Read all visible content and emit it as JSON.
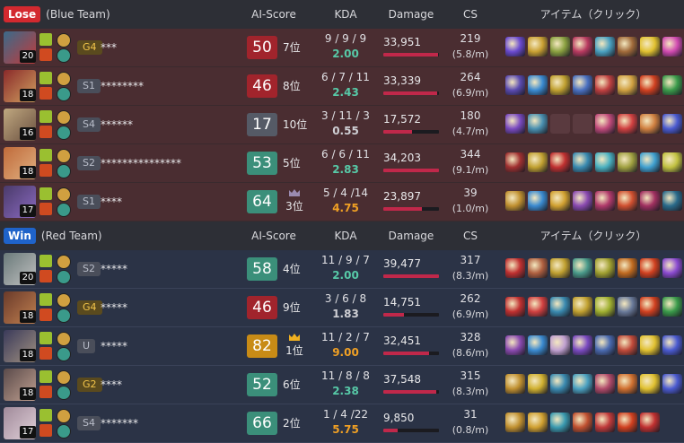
{
  "colors": {
    "score_red": "#a1242c",
    "score_green": "#3b8f7a",
    "score_gray": "#555a66",
    "score_gold": "#c88b16",
    "kda_green": "#57c9a7",
    "kda_gray": "#cfcfd4",
    "kda_orange": "#f0a024"
  },
  "headers": {
    "ai_score": "AI-Score",
    "kda": "KDA",
    "damage": "Damage",
    "cs": "CS",
    "items": "アイテム（クリック）"
  },
  "teams": [
    {
      "result": "Lose",
      "name": "(Blue Team)",
      "type": "lose",
      "players": [
        {
          "level": "20",
          "tier": "G4",
          "tier_type": "gold",
          "name": "***",
          "score": "50",
          "score_color": "score_red",
          "rank": "7位",
          "crown": false,
          "kda": "9 / 9 / 9",
          "kda_ratio": "2.00",
          "ratio_color": "kda_green",
          "damage": "33,951",
          "damage_frac": 0.99,
          "cs": "219",
          "cs_min": "(5.8/m)",
          "champ_colors": [
            "#3a6a8a",
            "#c23a3a"
          ],
          "items": [
            "#6a4ad0",
            "#c9a032",
            "#8aa040",
            "#b83a60",
            "#4aa0c0",
            "#a06a3a",
            "#e0c030",
            "#d04ab0"
          ]
        },
        {
          "level": "18",
          "tier": "S1",
          "tier_type": "gray",
          "name": "********",
          "score": "46",
          "score_color": "score_red",
          "rank": "8位",
          "crown": false,
          "kda": "6 / 7 / 11",
          "kda_ratio": "2.43",
          "ratio_color": "kda_green",
          "damage": "33,339",
          "damage_frac": 0.97,
          "cs": "264",
          "cs_min": "(6.9/m)",
          "champ_colors": [
            "#8a2a2a",
            "#d0a060"
          ],
          "items": [
            "#5a4ab0",
            "#3a8ad0",
            "#c0a030",
            "#4a70c0",
            "#c04040",
            "#d0a040",
            "#d04020",
            "#3a9a4a"
          ]
        },
        {
          "level": "16",
          "tier": "S4",
          "tier_type": "gray",
          "name": "******",
          "score": "17",
          "score_color": "score_gray",
          "rank": "10位",
          "crown": false,
          "kda": "3 / 11 / 3",
          "kda_ratio": "0.55",
          "ratio_color": "kda_gray",
          "damage": "17,572",
          "damage_frac": 0.51,
          "cs": "180",
          "cs_min": "(4.7/m)",
          "champ_colors": [
            "#c0a880",
            "#6a5040"
          ],
          "items": [
            "#7a4ac0",
            "#4a90b0",
            "",
            "",
            "#c04a7a",
            "#d04040",
            "#d08040",
            "#4a5ad0"
          ]
        },
        {
          "level": "18",
          "tier": "S2",
          "tier_type": "gray",
          "name": "***************",
          "score": "53",
          "score_color": "score_green",
          "rank": "5位",
          "crown": false,
          "kda": "6 / 6 / 11",
          "kda_ratio": "2.83",
          "ratio_color": "kda_green",
          "damage": "34,203",
          "damage_frac": 1.0,
          "cs": "344",
          "cs_min": "(9.1/m)",
          "champ_colors": [
            "#c06a3a",
            "#e0b080"
          ],
          "items": [
            "#a03030",
            "#c0a030",
            "#c03030",
            "#3a8ab0",
            "#4ab0c0",
            "#a0a040",
            "#40a0d0",
            "#c0c040"
          ]
        },
        {
          "level": "17",
          "tier": "S1",
          "tier_type": "gray",
          "name": "****",
          "score": "64",
          "score_color": "score_green",
          "rank": "3位",
          "crown": true,
          "crown_color": "#9a8ab0",
          "kda": "5 / 4 /14",
          "kda_ratio": "4.75",
          "ratio_color": "kda_orange",
          "damage": "23,897",
          "damage_frac": 0.7,
          "cs": "39",
          "cs_min": "(1.0/m)",
          "champ_colors": [
            "#4a3a6a",
            "#8a6ac0"
          ],
          "items": [
            "#c09030",
            "#3a8ad0",
            "#d0a030",
            "#8a4ab0",
            "#b03a6a",
            "#d05030",
            "#a03060",
            "#2a6a8a"
          ]
        }
      ]
    },
    {
      "result": "Win",
      "name": "(Red Team)",
      "type": "win",
      "players": [
        {
          "level": "20",
          "tier": "S2",
          "tier_type": "gray",
          "name": "*****",
          "score": "58",
          "score_color": "score_green",
          "rank": "4位",
          "crown": false,
          "kda": "11 / 9 / 7",
          "kda_ratio": "2.00",
          "ratio_color": "kda_green",
          "damage": "39,477",
          "damage_frac": 1.0,
          "cs": "317",
          "cs_min": "(8.3/m)",
          "champ_colors": [
            "#6a7a7a",
            "#c0c0c0"
          ],
          "items": [
            "#c03030",
            "#b06040",
            "#c0a030",
            "#4a9a8a",
            "#a0a030",
            "#c06a20",
            "#d04020",
            "#8a4ad0"
          ]
        },
        {
          "level": "18",
          "tier": "G4",
          "tier_type": "gold",
          "name": "*****",
          "score": "46",
          "score_color": "score_red",
          "rank": "9位",
          "crown": false,
          "kda": "3 / 6 / 8",
          "kda_ratio": "1.83",
          "ratio_color": "kda_gray",
          "damage": "14,751",
          "damage_frac": 0.37,
          "cs": "262",
          "cs_min": "(6.9/m)",
          "champ_colors": [
            "#6a3a2a",
            "#c08050"
          ],
          "items": [
            "#c03030",
            "#d04040",
            "#3a8ab0",
            "#c0a030",
            "#a0b030",
            "#6a7a9a",
            "#d04020",
            "#3a9a4a"
          ]
        },
        {
          "level": "18",
          "tier": "U",
          "tier_type": "gray",
          "name": "*****",
          "score": "82",
          "score_color": "score_gold",
          "rank": "1位",
          "crown": true,
          "crown_color": "#f0b020",
          "kda": "11 / 2 / 7",
          "kda_ratio": "9.00",
          "ratio_color": "kda_orange",
          "damage": "32,451",
          "damage_frac": 0.82,
          "cs": "328",
          "cs_min": "(8.6/m)",
          "champ_colors": [
            "#3a3a5a",
            "#a09080"
          ],
          "items": [
            "#8a4ab0",
            "#3a8ad0",
            "#c0a0d0",
            "#7a4ac0",
            "#4a6ab0",
            "#c04a3a",
            "#e0c030",
            "#4a5ad0"
          ]
        },
        {
          "level": "18",
          "tier": "G2",
          "tier_type": "gold",
          "name": "****",
          "score": "52",
          "score_color": "score_green",
          "rank": "6位",
          "crown": false,
          "kda": "11 / 8 / 8",
          "kda_ratio": "2.38",
          "ratio_color": "kda_green",
          "damage": "37,548",
          "damage_frac": 0.95,
          "cs": "315",
          "cs_min": "(8.3/m)",
          "champ_colors": [
            "#5a4a4a",
            "#c0a090"
          ],
          "items": [
            "#c09030",
            "#d0b030",
            "#3a8ab0",
            "#4aa0c0",
            "#b04a6a",
            "#d07030",
            "#e0c030",
            "#4a5ad0"
          ]
        },
        {
          "level": "17",
          "tier": "S4",
          "tier_type": "gray",
          "name": "*******",
          "score": "66",
          "score_color": "score_green",
          "rank": "2位",
          "crown": false,
          "kda": "1 / 4 /22",
          "kda_ratio": "5.75",
          "ratio_color": "kda_orange",
          "damage": "9,850",
          "damage_frac": 0.25,
          "cs": "31",
          "cs_min": "(0.8/m)",
          "champ_colors": [
            "#a08a9a",
            "#e0d0d8"
          ],
          "items": [
            "#c09030",
            "#d0a030",
            "#3a9ab0",
            "#c05030",
            "#c03a3a",
            "#d04020",
            "#c03030"
          ]
        }
      ]
    }
  ]
}
